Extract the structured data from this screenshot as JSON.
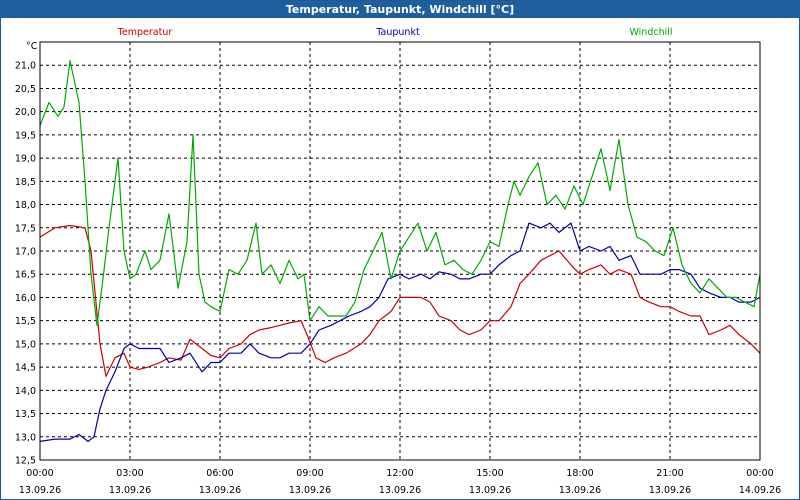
{
  "window": {
    "title": "Temperatur, Taupunkt, Windchill [°C]"
  },
  "chart_data": {
    "type": "line",
    "title": "Temperatur, Taupunkt, Windchill [°C]",
    "ylabel": "°C",
    "xlabel": "",
    "ylim": [
      12.5,
      21.5
    ],
    "yticks": [
      "12,5",
      "13,0",
      "13,5",
      "14,0",
      "14,5",
      "15,0",
      "15,5",
      "16,0",
      "16,5",
      "17,0",
      "17,5",
      "18,0",
      "18,5",
      "19,0",
      "19,5",
      "20,0",
      "20,5",
      "21,0"
    ],
    "xlim": [
      0,
      24
    ],
    "xticks": [
      {
        "time": "00:00",
        "date": "13.09.26"
      },
      {
        "time": "03:00",
        "date": "13.09.26"
      },
      {
        "time": "06:00",
        "date": "13.09.26"
      },
      {
        "time": "09:00",
        "date": "13.09.26"
      },
      {
        "time": "12:00",
        "date": "13.09.26"
      },
      {
        "time": "15:00",
        "date": "13.09.26"
      },
      {
        "time": "18:00",
        "date": "13.09.26"
      },
      {
        "time": "21:00",
        "date": "13.09.26"
      },
      {
        "time": "00:00",
        "date": "14.09.26"
      }
    ],
    "grid": true,
    "legend": "top",
    "series": [
      {
        "name": "Temperatur",
        "color": "#cc0000",
        "x": [
          0,
          0.5,
          1,
          1.5,
          1.7,
          2,
          2.2,
          2.5,
          2.8,
          3,
          3.3,
          3.6,
          4,
          4.3,
          4.7,
          5,
          5.4,
          5.7,
          6,
          6.3,
          6.7,
          7,
          7.3,
          7.7,
          8,
          8.3,
          8.7,
          8.9,
          9.2,
          9.5,
          9.8,
          10.2,
          10.7,
          11,
          11.3,
          11.7,
          12,
          12.3,
          12.7,
          13,
          13.3,
          13.7,
          14,
          14.3,
          14.7,
          15,
          15.3,
          15.7,
          16,
          16.3,
          16.7,
          17,
          17.3,
          17.7,
          18,
          18.3,
          18.7,
          19,
          19.3,
          19.7,
          20,
          20.3,
          20.7,
          21,
          21.3,
          21.7,
          22,
          22.3,
          22.7,
          23,
          23.3,
          23.7,
          24
        ],
        "values": [
          17.3,
          17.5,
          17.55,
          17.5,
          17.0,
          15.0,
          14.3,
          14.7,
          14.8,
          14.5,
          14.45,
          14.5,
          14.6,
          14.7,
          14.65,
          15.1,
          14.9,
          14.75,
          14.7,
          14.9,
          15.0,
          15.2,
          15.3,
          15.35,
          15.4,
          15.45,
          15.5,
          15.2,
          14.7,
          14.6,
          14.7,
          14.8,
          15.0,
          15.2,
          15.5,
          15.7,
          16.0,
          16.0,
          16.0,
          15.9,
          15.6,
          15.5,
          15.3,
          15.2,
          15.3,
          15.5,
          15.5,
          15.8,
          16.3,
          16.5,
          16.8,
          16.9,
          17.0,
          16.7,
          16.5,
          16.6,
          16.7,
          16.5,
          16.6,
          16.5,
          16.0,
          15.9,
          15.8,
          15.8,
          15.7,
          15.6,
          15.6,
          15.2,
          15.3,
          15.4,
          15.2,
          15.0,
          14.8
        ]
      },
      {
        "name": "Taupunkt",
        "color": "#0000aa",
        "x": [
          0,
          0.5,
          1,
          1.3,
          1.6,
          1.8,
          2,
          2.2,
          2.5,
          2.8,
          3,
          3.3,
          3.6,
          4,
          4.3,
          4.7,
          5,
          5.4,
          5.7,
          6,
          6.3,
          6.7,
          7,
          7.3,
          7.7,
          8,
          8.3,
          8.7,
          9,
          9.3,
          9.7,
          10,
          10.3,
          10.7,
          11,
          11.3,
          11.6,
          12,
          12.3,
          12.7,
          13,
          13.3,
          13.7,
          14,
          14.3,
          14.7,
          15,
          15.3,
          15.7,
          16,
          16.3,
          16.7,
          17,
          17.3,
          17.7,
          18,
          18.3,
          18.7,
          19,
          19.3,
          19.7,
          20,
          20.3,
          20.7,
          21,
          21.3,
          21.7,
          22,
          22.3,
          22.7,
          23,
          23.3,
          23.7,
          24
        ],
        "values": [
          12.9,
          12.95,
          12.95,
          13.05,
          12.9,
          13.0,
          13.6,
          14.0,
          14.4,
          14.9,
          15.0,
          14.9,
          14.9,
          14.9,
          14.6,
          14.7,
          14.8,
          14.4,
          14.6,
          14.6,
          14.8,
          14.8,
          15.0,
          14.8,
          14.7,
          14.7,
          14.8,
          14.8,
          15.0,
          15.3,
          15.4,
          15.5,
          15.6,
          15.7,
          15.8,
          16.0,
          16.4,
          16.5,
          16.4,
          16.5,
          16.4,
          16.55,
          16.5,
          16.4,
          16.4,
          16.5,
          16.5,
          16.7,
          16.9,
          17.0,
          17.6,
          17.5,
          17.6,
          17.4,
          17.6,
          17.0,
          17.1,
          17.0,
          17.1,
          16.8,
          16.9,
          16.5,
          16.5,
          16.5,
          16.6,
          16.6,
          16.5,
          16.2,
          16.1,
          16.0,
          16.0,
          15.9,
          15.9,
          16.0
        ]
      },
      {
        "name": "Windchill",
        "color": "#00aa00",
        "x": [
          0,
          0.3,
          0.6,
          0.8,
          1,
          1.3,
          1.5,
          1.7,
          1.9,
          2.1,
          2.3,
          2.6,
          2.8,
          3,
          3.2,
          3.5,
          3.7,
          4,
          4.3,
          4.6,
          4.9,
          5.1,
          5.3,
          5.5,
          5.7,
          6,
          6.3,
          6.6,
          6.9,
          7.2,
          7.4,
          7.7,
          8,
          8.3,
          8.6,
          8.8,
          9,
          9.3,
          9.6,
          9.9,
          10.2,
          10.5,
          10.8,
          11.1,
          11.4,
          11.7,
          12,
          12.3,
          12.6,
          12.9,
          13.2,
          13.5,
          13.8,
          14.1,
          14.4,
          14.7,
          15,
          15.3,
          15.6,
          15.8,
          16,
          16.3,
          16.6,
          16.9,
          17.2,
          17.5,
          17.8,
          18.1,
          18.4,
          18.7,
          19,
          19.3,
          19.6,
          19.9,
          20.2,
          20.5,
          20.8,
          21.1,
          21.4,
          21.7,
          22,
          22.3,
          22.6,
          22.9,
          23.2,
          23.5,
          23.8,
          24
        ],
        "values": [
          19.7,
          20.2,
          19.9,
          20.1,
          21.1,
          20.2,
          18.5,
          16.5,
          15.4,
          16.4,
          17.5,
          19.0,
          17.0,
          16.4,
          16.5,
          17.0,
          16.6,
          16.8,
          17.8,
          16.2,
          17.2,
          19.5,
          16.5,
          15.9,
          15.8,
          15.7,
          16.6,
          16.5,
          16.8,
          17.6,
          16.5,
          16.7,
          16.3,
          16.8,
          16.4,
          16.5,
          15.5,
          15.8,
          15.6,
          15.6,
          15.6,
          15.9,
          16.6,
          17.0,
          17.4,
          16.4,
          17.0,
          17.3,
          17.6,
          17.0,
          17.4,
          16.7,
          16.8,
          16.6,
          16.5,
          16.8,
          17.2,
          17.1,
          18.0,
          18.5,
          18.2,
          18.6,
          18.9,
          18.0,
          18.2,
          17.9,
          18.4,
          18.0,
          18.6,
          19.2,
          18.3,
          19.4,
          18.0,
          17.3,
          17.2,
          17.0,
          16.9,
          17.5,
          16.7,
          16.3,
          16.1,
          16.4,
          16.2,
          16.0,
          16.0,
          15.9,
          15.8,
          16.5
        ]
      }
    ]
  }
}
